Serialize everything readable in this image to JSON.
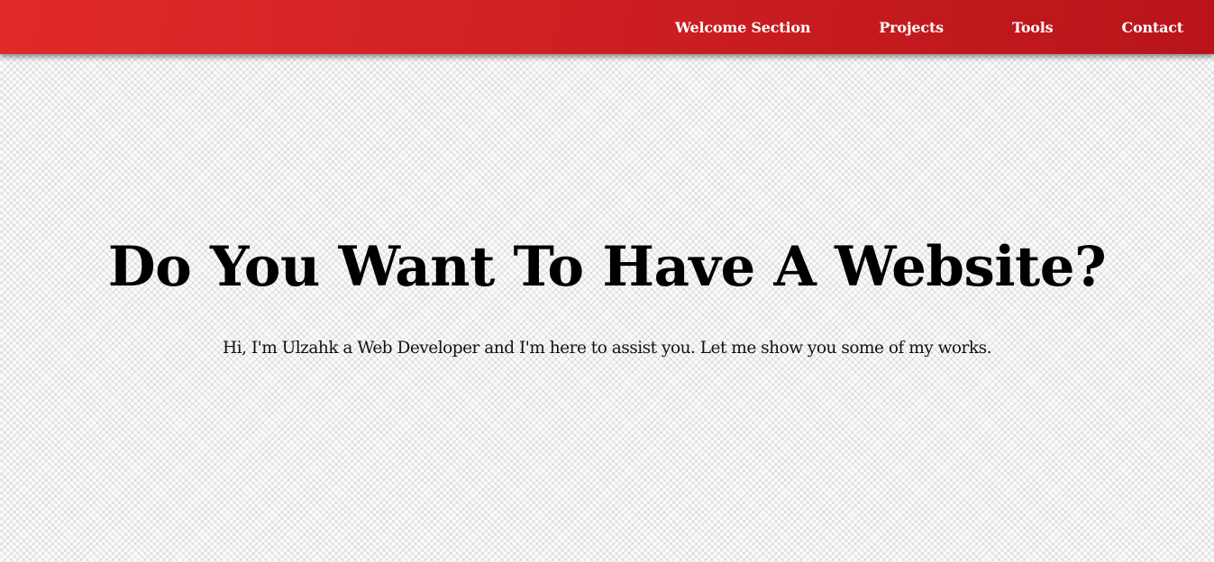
{
  "nav": {
    "items": [
      {
        "label": "Welcome Section"
      },
      {
        "label": "Projects"
      },
      {
        "label": "Tools"
      },
      {
        "label": "Contact"
      }
    ]
  },
  "welcome": {
    "title": "Do You Want To Have A Website?",
    "subtitle": "Hi, I'm Ulzahk a Web Developer and I'm here to assist you. Let me show you some of my works."
  },
  "colors": {
    "navbar_accent": "#d32224",
    "nav_text": "#ffffff",
    "heading_text": "#000000"
  }
}
